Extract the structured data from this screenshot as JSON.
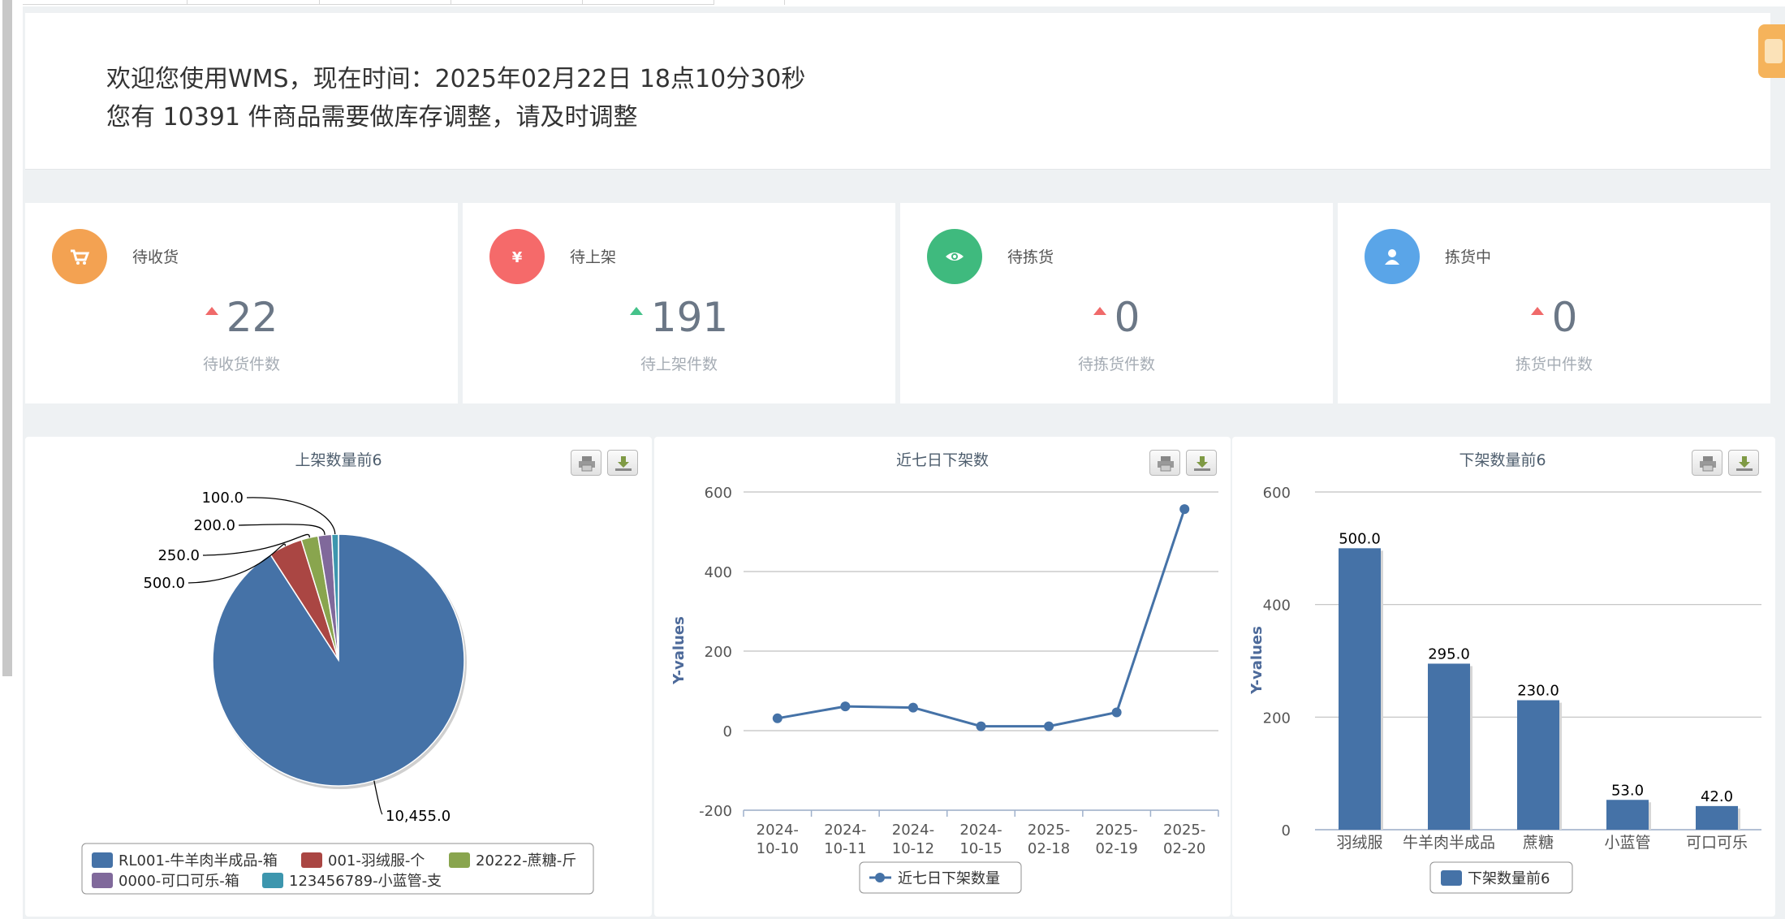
{
  "welcome": {
    "line1": "欢迎您使用WMS，现在时间：2025年02月22日 18点10分30秒",
    "line2": "您有 10391 件商品需要做库存调整，请及时调整"
  },
  "stats": [
    {
      "title": "待收货",
      "value": "22",
      "label": "待收货件数",
      "icon": "cart-icon",
      "color": "#f3a252",
      "trend": "up",
      "trend_color": "#f06a6a"
    },
    {
      "title": "待上架",
      "value": "191",
      "label": "待上架件数",
      "icon": "yen-icon",
      "color": "#f56a6a",
      "trend": "up",
      "trend_color": "#45c28a"
    },
    {
      "title": "待拣货",
      "value": "0",
      "label": "待拣货件数",
      "icon": "eye-icon",
      "color": "#3fba7e",
      "trend": "up",
      "trend_color": "#f06a6a"
    },
    {
      "title": "拣货中",
      "value": "0",
      "label": "拣货中件数",
      "icon": "user-icon",
      "color": "#5aa5e8",
      "trend": "up",
      "trend_color": "#f06a6a"
    }
  ],
  "toolbar": {
    "print_icon": "print-icon",
    "download_icon": "download-icon"
  },
  "chart_data": [
    {
      "type": "pie",
      "title": "上架数量前6",
      "categories": [
        "RL001-牛羊肉半成品-箱",
        "001-羽绒服-个",
        "20222-蔗糖-斤",
        "0000-可口可乐-箱",
        "123456789-小蓝管-支"
      ],
      "values": [
        10455,
        500,
        250,
        200,
        100
      ],
      "labels": [
        "10,455.0",
        "500.0",
        "250.0",
        "200.0",
        "100.0"
      ],
      "colors": [
        "#4572a7",
        "#aa4643",
        "#89a54e",
        "#80699b",
        "#3d96ae"
      ],
      "legend": "bottom"
    },
    {
      "type": "line",
      "title": "近七日下架数",
      "categories": [
        "2024-10-10",
        "2024-10-11",
        "2024-10-12",
        "2024-10-15",
        "2025-02-18",
        "2025-02-19",
        "2025-02-20"
      ],
      "series": [
        {
          "name": "近七日下架数量",
          "values": [
            31,
            61,
            58,
            11,
            11,
            46,
            557
          ]
        }
      ],
      "ylabel": "Y-values",
      "ylim": [
        -200,
        600
      ],
      "yticks": [
        "600",
        "400",
        "200",
        "0",
        "-200"
      ],
      "grid": true,
      "legend": "bottom"
    },
    {
      "type": "bar",
      "title": "下架数量前6",
      "categories": [
        "羽绒服",
        "牛羊肉半成品",
        "蔗糖",
        "小蓝管",
        "可口可乐"
      ],
      "series": [
        {
          "name": "下架数量前6",
          "values": [
            500,
            295,
            230,
            53,
            42
          ]
        }
      ],
      "data_labels": [
        "500.0",
        "295.0",
        "230.0",
        "53.0",
        "42.0"
      ],
      "ylabel": "Y-values",
      "ylim": [
        0,
        600
      ],
      "yticks": [
        "600",
        "400",
        "200",
        "0"
      ],
      "grid": true,
      "legend": "bottom"
    }
  ]
}
